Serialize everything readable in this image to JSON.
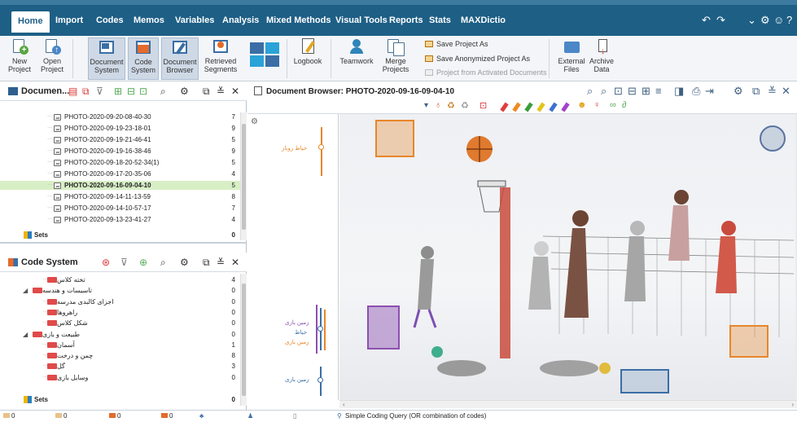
{
  "menubar": {
    "tabs": [
      "Home",
      "Import",
      "Codes",
      "Memos",
      "Variables",
      "Analysis",
      "Mixed Methods",
      "Visual Tools",
      "Reports",
      "Stats",
      "MAXDictio"
    ],
    "active_tab": "Home"
  },
  "ribbon": {
    "new_project": "New Project",
    "open_project": "Open Project",
    "document_system": "Document System",
    "code_system": "Code System",
    "document_browser": "Document Browser",
    "retrieved_segments": "Retrieved Segments",
    "logbook": "Logbook",
    "teamwork": "Teamwork",
    "merge_projects": "Merge Projects",
    "save_project_as": "Save Project As",
    "save_anonymized": "Save Anonymized Project As",
    "project_from_activated": "Project from Activated Documents",
    "external_files": "External Files",
    "archive_data": "Archive Data"
  },
  "document_panel": {
    "title": "Documen...",
    "rows": [
      {
        "name": "PHOTO-2020-09-20-08-40-30",
        "count": "7"
      },
      {
        "name": "PHOTO-2020-09-19-23-18-01",
        "count": "9"
      },
      {
        "name": "PHOTO-2020-09-19-21-46-41",
        "count": "5"
      },
      {
        "name": "PHOTO-2020-09-19-16-38-46",
        "count": "9"
      },
      {
        "name": "PHOTO-2020-09-18-20-52-34(1)",
        "count": "5"
      },
      {
        "name": "PHOTO-2020-09-17-20-35-06",
        "count": "4"
      },
      {
        "name": "PHOTO-2020-09-16-09-04-10",
        "count": "5"
      },
      {
        "name": "PHOTO-2020-09-14-11-13-59",
        "count": "8"
      },
      {
        "name": "PHOTO-2020-09-14-10-57-17",
        "count": "7"
      },
      {
        "name": "PHOTO-2020-09-13-23-41-27",
        "count": "4"
      }
    ],
    "selected_row": "PHOTO-2020-09-16-09-04-10",
    "sets_label": "Sets",
    "sets_count": "0"
  },
  "code_panel": {
    "title": "Code System",
    "rows": [
      {
        "name": "تخته کلاس",
        "count": "4",
        "level": 2
      },
      {
        "name": "تاسیسات و هندسه",
        "count": "0",
        "level": 1
      },
      {
        "name": "اجزای کالبدی مدرسه",
        "count": "0",
        "level": 2
      },
      {
        "name": "راهروها",
        "count": "0",
        "level": 2
      },
      {
        "name": "شکل کلاس",
        "count": "0",
        "level": 2
      },
      {
        "name": "طبیعت و بازی",
        "count": "0",
        "level": 1
      },
      {
        "name": "آسمان",
        "count": "1",
        "level": 2
      },
      {
        "name": "چمن و درخت",
        "count": "8",
        "level": 2
      },
      {
        "name": "گل",
        "count": "3",
        "level": 2
      },
      {
        "name": "وسایل بازی",
        "count": "0",
        "level": 2
      }
    ],
    "sets_label": "Sets",
    "sets_count": "0"
  },
  "browser": {
    "title": "Document Browser: PHOTO-2020-09-16-09-04-10",
    "margin_codes": [
      "حیاط روباز",
      "زمین بازی",
      "حیاط",
      "زمین بازی",
      "زمین بازی"
    ]
  },
  "status": {
    "items": [
      "0",
      "0",
      "0",
      "0"
    ],
    "query": "Simple Coding Query (OR combination of codes)"
  },
  "colors": {
    "menubar": "#1e5f86",
    "selection": "#d8efc6",
    "code_orange": "#e8862a",
    "code_purple": "#8c4fb0",
    "code_blue": "#3a6ea5"
  }
}
